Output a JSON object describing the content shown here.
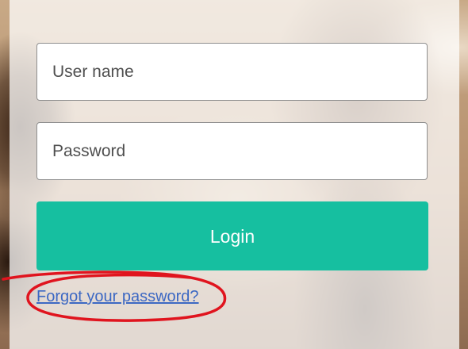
{
  "login_form": {
    "username": {
      "placeholder": "User name",
      "value": ""
    },
    "password": {
      "placeholder": "Password",
      "value": ""
    },
    "login_label": "Login",
    "forgot_label": "Forgot your password?"
  },
  "colors": {
    "primary_button": "#16bfa0",
    "link": "#3c68c3",
    "annotation_stroke": "#e0141e"
  }
}
